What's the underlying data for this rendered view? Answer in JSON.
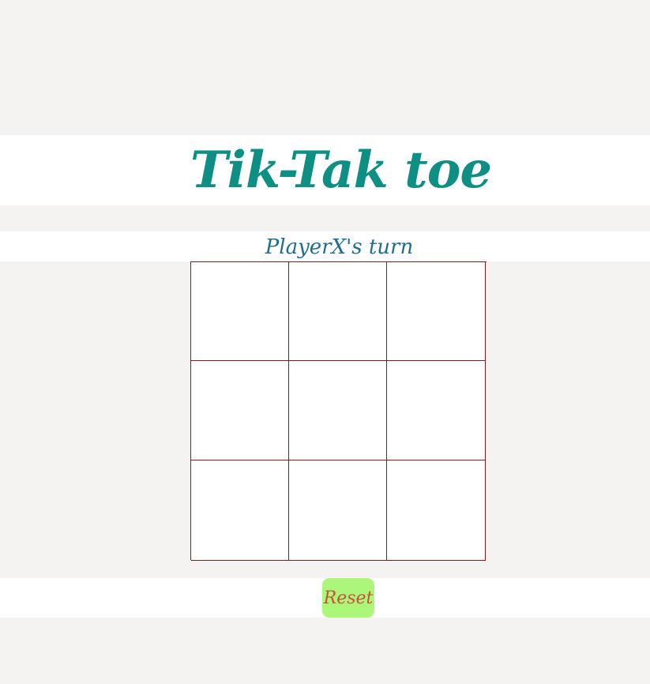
{
  "header": {
    "title": "Tik-Tak toe"
  },
  "status": {
    "turn_text": "PlayerX's turn"
  },
  "board": {
    "cells": [
      "",
      "",
      "",
      "",
      "",
      "",
      "",
      "",
      ""
    ]
  },
  "controls": {
    "reset_label": "Reset"
  },
  "colors": {
    "title": "#0e8f83",
    "turn_text": "#1f6f8b",
    "grid_lines": "#8b1a1a",
    "reset_bg": "#acf67a",
    "reset_text": "#c4553a",
    "page_bg": "#f4f3f1",
    "band_bg": "#ffffff"
  }
}
